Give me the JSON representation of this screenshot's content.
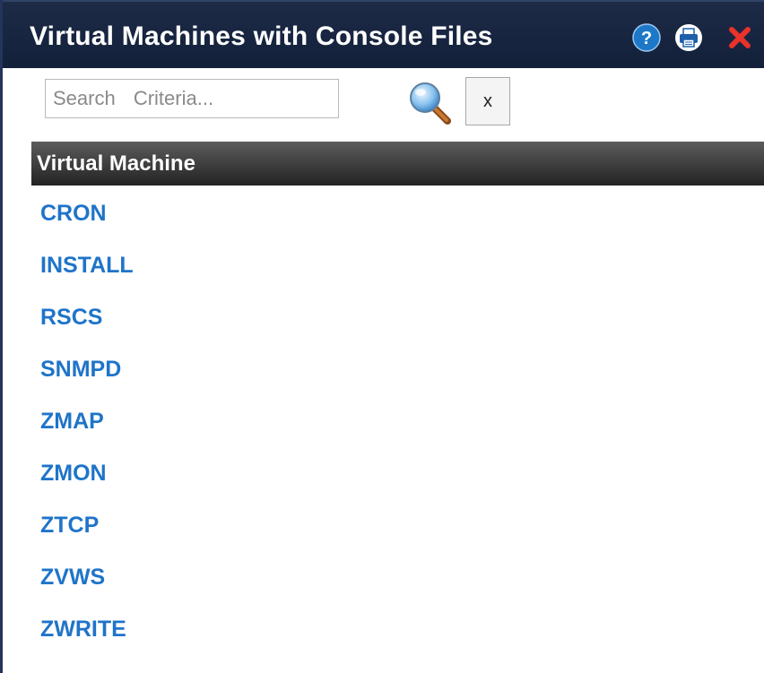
{
  "window": {
    "title": "Virtual Machines with Console Files",
    "icons": [
      "help-icon",
      "print-icon",
      "close-icon"
    ]
  },
  "search": {
    "placeholder": "Search Criteria...",
    "value": "",
    "search_icon": "magnifier-icon",
    "clear_label": "x"
  },
  "table": {
    "column_header": "Virtual Machine",
    "rows": [
      "CRON",
      "INSTALL",
      "RSCS",
      "SNMPD",
      "ZMAP",
      "ZMON",
      "ZTCP",
      "ZVWS",
      "ZWRITE"
    ]
  },
  "colors": {
    "titlebar": "#1d2b47",
    "link": "#1f74c9",
    "header": "#3a3a3a",
    "close": "#e8322a",
    "help": "#1e78c8"
  }
}
